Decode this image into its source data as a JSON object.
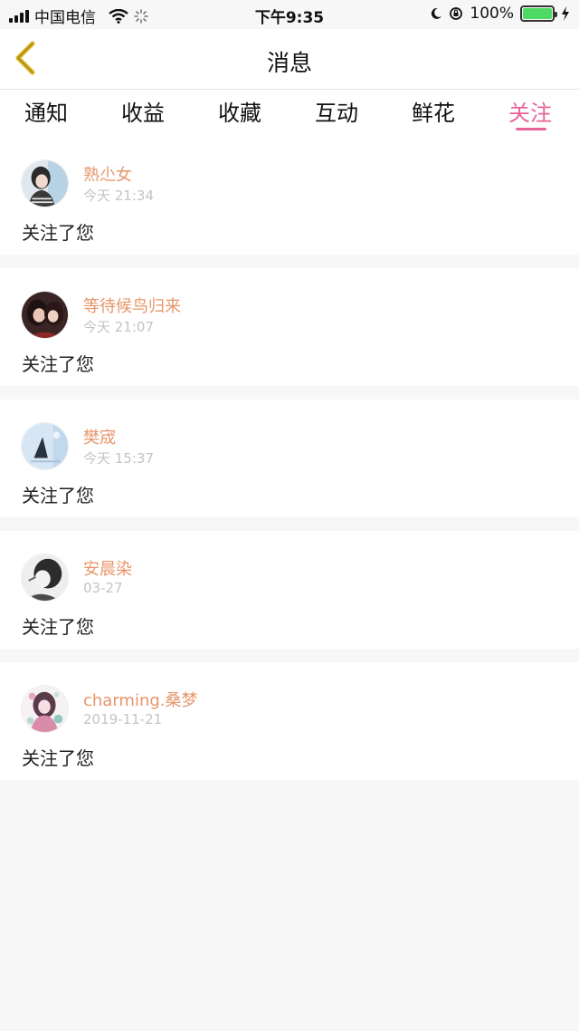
{
  "status_bar": {
    "carrier": "中国电信",
    "time": "下午9:35",
    "battery": "100%"
  },
  "header": {
    "title": "消息",
    "back_icon": "chevron-left-icon"
  },
  "tabs": [
    {
      "label": "通知",
      "active": false
    },
    {
      "label": "收益",
      "active": false
    },
    {
      "label": "收藏",
      "active": false
    },
    {
      "label": "互动",
      "active": false
    },
    {
      "label": "鲜花",
      "active": false
    },
    {
      "label": "关注",
      "active": true
    }
  ],
  "colors": {
    "accent": "#e7649b",
    "username": "#e8956a",
    "timestamp": "#c4c4c4",
    "battery": "#4cd964"
  },
  "notifications": [
    {
      "username": "熟尐女",
      "time": "今天 21:34",
      "message": "关注了您"
    },
    {
      "username": "等待候鸟归来",
      "time": "今天 21:07",
      "message": "关注了您"
    },
    {
      "username": "樊宬",
      "time": "今天 15:37",
      "message": "关注了您"
    },
    {
      "username": "安晨染",
      "time": "03-27",
      "message": "关注了您"
    },
    {
      "username": "charming.桑梦",
      "time": "2019-11-21",
      "message": "关注了您"
    }
  ]
}
